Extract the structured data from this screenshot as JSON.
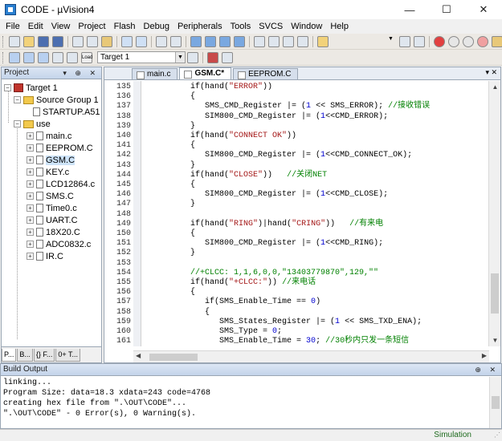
{
  "window": {
    "title": "CODE  -  µVision4",
    "minimize": "—",
    "maximize": "☐",
    "close": "✕"
  },
  "menu": [
    "File",
    "Edit",
    "View",
    "Project",
    "Flash",
    "Debug",
    "Peripherals",
    "Tools",
    "SVCS",
    "Window",
    "Help"
  ],
  "toolbar2": {
    "target": "Target 1",
    "load_label": "Load"
  },
  "project_panel": {
    "header": "Project",
    "root": "Target 1",
    "group1": "Source Group 1",
    "group1_files": [
      "STARTUP.A51"
    ],
    "group2": "use",
    "group2_files": [
      "main.c",
      "EEPROM.C",
      "GSM.C",
      "KEY.c",
      "LCD12864.c",
      "SMS.C",
      "Time0.c",
      "UART.C",
      "18X20.C",
      "ADC0832.c",
      "IR.C"
    ],
    "selected": "GSM.C",
    "tabs": [
      "P...",
      "B...",
      "{} F...",
      "0+ T..."
    ]
  },
  "editor": {
    "tabs": [
      "main.c",
      "GSM.C*",
      "EEPROM.C"
    ],
    "active_tab": "GSM.C*",
    "line_numbers": [
      135,
      136,
      137,
      138,
      139,
      140,
      141,
      142,
      143,
      144,
      145,
      146,
      147,
      148,
      149,
      150,
      151,
      152,
      153,
      154,
      155,
      156,
      157,
      158,
      159,
      160,
      161
    ],
    "lines": [
      [
        {
          "t": "          if(hand(",
          "c": ""
        },
        {
          "t": "\"ERROR\"",
          "c": "str"
        },
        {
          "t": "))",
          "c": ""
        }
      ],
      [
        {
          "t": "          {",
          "c": ""
        }
      ],
      [
        {
          "t": "             SMS_CMD_Register |= (",
          "c": ""
        },
        {
          "t": "1",
          "c": "kw"
        },
        {
          "t": " << SMS_ERROR); ",
          "c": ""
        },
        {
          "t": "//接收错误",
          "c": "cm"
        }
      ],
      [
        {
          "t": "             SIM800_CMD_Register |= (",
          "c": ""
        },
        {
          "t": "1",
          "c": "kw"
        },
        {
          "t": "<<CMD_ERROR);",
          "c": ""
        }
      ],
      [
        {
          "t": "          }",
          "c": ""
        }
      ],
      [
        {
          "t": "          if(hand(",
          "c": ""
        },
        {
          "t": "\"CONNECT OK\"",
          "c": "str"
        },
        {
          "t": "))",
          "c": ""
        }
      ],
      [
        {
          "t": "          {",
          "c": ""
        }
      ],
      [
        {
          "t": "             SIM800_CMD_Register |= (",
          "c": ""
        },
        {
          "t": "1",
          "c": "kw"
        },
        {
          "t": "<<CMD_CONNECT_OK);",
          "c": ""
        }
      ],
      [
        {
          "t": "          }",
          "c": ""
        }
      ],
      [
        {
          "t": "          if(hand(",
          "c": ""
        },
        {
          "t": "\"CLOSE\"",
          "c": "str"
        },
        {
          "t": "))   ",
          "c": ""
        },
        {
          "t": "//关闭NET",
          "c": "cm"
        }
      ],
      [
        {
          "t": "          {",
          "c": ""
        }
      ],
      [
        {
          "t": "             SIM800_CMD_Register |= (",
          "c": ""
        },
        {
          "t": "1",
          "c": "kw"
        },
        {
          "t": "<<CMD_CLOSE);",
          "c": ""
        }
      ],
      [
        {
          "t": "          }",
          "c": ""
        }
      ],
      [
        {
          "t": "",
          "c": ""
        }
      ],
      [
        {
          "t": "          if(hand(",
          "c": ""
        },
        {
          "t": "\"RING\"",
          "c": "str"
        },
        {
          "t": ")|hand(",
          "c": ""
        },
        {
          "t": "\"CRING\"",
          "c": "str"
        },
        {
          "t": "))   ",
          "c": ""
        },
        {
          "t": "//有来电",
          "c": "cm"
        }
      ],
      [
        {
          "t": "          {",
          "c": ""
        }
      ],
      [
        {
          "t": "             SIM800_CMD_Register |= (",
          "c": ""
        },
        {
          "t": "1",
          "c": "kw"
        },
        {
          "t": "<<CMD_RING);",
          "c": ""
        }
      ],
      [
        {
          "t": "          }",
          "c": ""
        }
      ],
      [
        {
          "t": "",
          "c": ""
        }
      ],
      [
        {
          "t": "          ",
          "c": ""
        },
        {
          "t": "//+CLCC: 1,1,6,0,0,\"13403779870\",129,\"\"",
          "c": "cm"
        }
      ],
      [
        {
          "t": "          if(hand(",
          "c": ""
        },
        {
          "t": "\"+CLCC:\"",
          "c": "str"
        },
        {
          "t": ")) ",
          "c": ""
        },
        {
          "t": "//来电话",
          "c": "cm"
        }
      ],
      [
        {
          "t": "          {",
          "c": ""
        }
      ],
      [
        {
          "t": "             if(SMS_Enable_Time == ",
          "c": ""
        },
        {
          "t": "0",
          "c": "kw"
        },
        {
          "t": ")",
          "c": ""
        }
      ],
      [
        {
          "t": "             {",
          "c": ""
        }
      ],
      [
        {
          "t": "                SMS_States_Register |= (",
          "c": ""
        },
        {
          "t": "1",
          "c": "kw"
        },
        {
          "t": " << SMS_TXD_ENA);",
          "c": ""
        }
      ],
      [
        {
          "t": "                SMS_Type = ",
          "c": ""
        },
        {
          "t": "0",
          "c": "kw"
        },
        {
          "t": ";",
          "c": ""
        }
      ],
      [
        {
          "t": "                SMS_Enable_Time = ",
          "c": ""
        },
        {
          "t": "30",
          "c": "kw"
        },
        {
          "t": "; ",
          "c": ""
        },
        {
          "t": "//30秒内只发一条短信",
          "c": "cm"
        }
      ]
    ]
  },
  "build_output": {
    "header": "Build Output",
    "lines": [
      "linking...",
      "Program Size: data=18.3 xdata=243 code=4768",
      "creating hex file from \".\\OUT\\CODE\"...",
      "\".\\OUT\\CODE\" - 0 Error(s), 0 Warning(s)."
    ]
  },
  "status": {
    "mode": "Simulation"
  }
}
